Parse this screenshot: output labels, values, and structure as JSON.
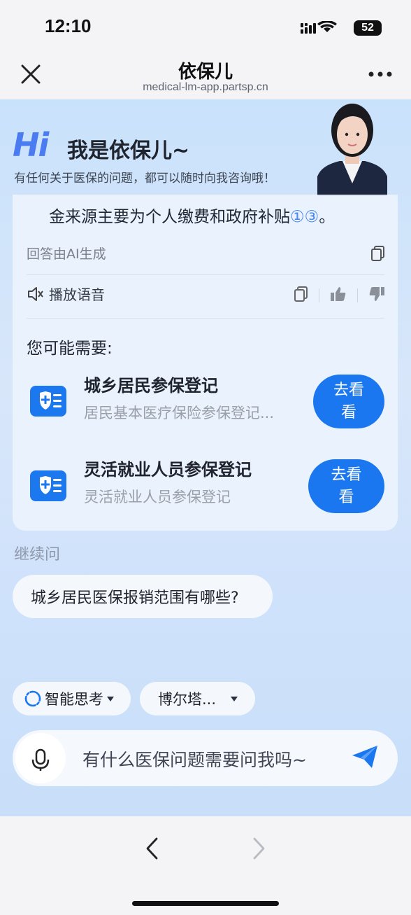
{
  "status_bar": {
    "time": "12:10",
    "battery": "52"
  },
  "nav": {
    "title": "依保儿",
    "url": "medical-lm-app.partsp.cn"
  },
  "header": {
    "hi_logo": "Hi",
    "greeting": "我是依保儿~",
    "subtitle": "有任何关于医保的问题，都可以随时向我咨询哦！"
  },
  "answer": {
    "text": "金来源主要为个人缴费和政府补贴",
    "citations": "①③",
    "period": "。",
    "ai_note": "回答由AI生成",
    "speak_label": "播放语音"
  },
  "suggestions": {
    "title": "您可能需要:",
    "items": [
      {
        "title": "城乡居民参保登记",
        "subtitle": "居民基本医疗保险参保登记...",
        "button": "去看看"
      },
      {
        "title": "灵活就业人员参保登记",
        "subtitle": "灵活就业人员参保登记",
        "button": "去看看"
      }
    ]
  },
  "continue": {
    "label": "继续问",
    "chip": "城乡居民医保报销范围有哪些?"
  },
  "controls": {
    "mode": "智能思考",
    "location": "博尔塔..."
  },
  "input": {
    "placeholder": "有什么医保问题需要问我吗~"
  },
  "colors": {
    "accent": "#1b77f0",
    "background": "#cfe2fb"
  }
}
